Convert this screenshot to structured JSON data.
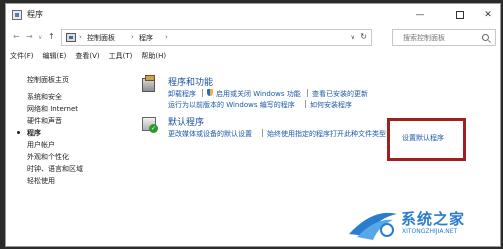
{
  "window": {
    "title": "程序"
  },
  "window_controls": {
    "minimize": "—",
    "maximize": "",
    "close": "✕"
  },
  "address": {
    "nav_back": "←",
    "nav_forward": "→",
    "nav_recent": "∨",
    "nav_up": "↑",
    "separator": "›",
    "crumbs": [
      "控制面板",
      "程序"
    ],
    "dropdown": "∨",
    "refresh": "↻"
  },
  "search": {
    "placeholder": "搜索控制面板"
  },
  "menu": [
    "文件(F)",
    "编辑(E)",
    "查看(V)",
    "工具(T)",
    "帮助(H)"
  ],
  "sidebar": {
    "items": [
      {
        "label": "控制面板主页",
        "current": false
      },
      {
        "label": "系统和安全",
        "current": false
      },
      {
        "label": "网络和 Internet",
        "current": false
      },
      {
        "label": "硬件和声音",
        "current": false
      },
      {
        "label": "程序",
        "current": true
      },
      {
        "label": "用户帐户",
        "current": false
      },
      {
        "label": "外观和个性化",
        "current": false
      },
      {
        "label": "时钟、语言和区域",
        "current": false
      },
      {
        "label": "轻松使用",
        "current": false
      }
    ]
  },
  "categories": {
    "programs": {
      "title": "程序和功能",
      "icon": "programs-icon",
      "links_row1": [
        "卸载程序",
        "启用或关闭 Windows 功能",
        "查看已安装的更新"
      ],
      "links_row2": [
        "运行为以前版本的 Windows 编写的程序",
        "如何安装程序"
      ]
    },
    "defaults": {
      "title": "默认程序",
      "icon": "default-programs-icon",
      "links_row1": [
        "更改媒体或设备的默认设置",
        "始终使用指定的程序打开此种文件类型"
      ],
      "highlighted_link": "设置默认程序"
    }
  },
  "colors": {
    "link": "#1a5aa8",
    "highlight_border": "#a02020",
    "watermark": "#2a7ccf"
  },
  "watermark": {
    "brand": "系统之家",
    "url": "XITONGZHIJIA.NET"
  }
}
